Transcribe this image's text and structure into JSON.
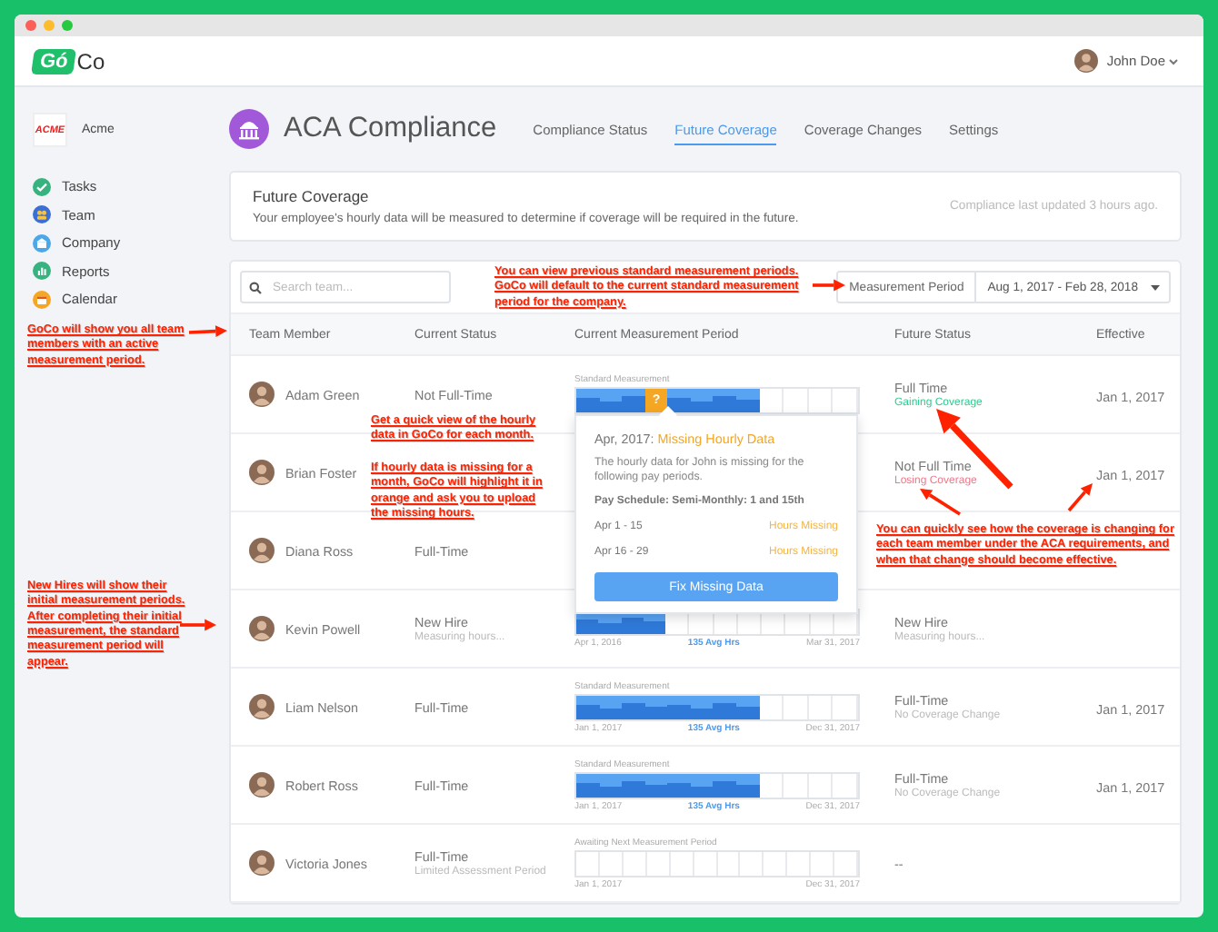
{
  "header": {
    "logo": {
      "mark": "Gó",
      "rest": "Co"
    },
    "user": {
      "name": "John Doe"
    }
  },
  "sidebar": {
    "company": {
      "logo": "ACME",
      "name": "Acme"
    },
    "items": [
      {
        "label": "Tasks",
        "kind": "tasks"
      },
      {
        "label": "Team",
        "kind": "team"
      },
      {
        "label": "Company",
        "kind": "company"
      },
      {
        "label": "Reports",
        "kind": "reports"
      },
      {
        "label": "Calendar",
        "kind": "calendar"
      }
    ]
  },
  "page": {
    "title": "ACA Compliance",
    "tabs": [
      {
        "label": "Compliance Status",
        "selected": false
      },
      {
        "label": "Future Coverage",
        "selected": true
      },
      {
        "label": "Coverage Changes",
        "selected": false
      },
      {
        "label": "Settings",
        "selected": false
      }
    ]
  },
  "summary": {
    "title": "Future Coverage",
    "description": "Your employee's hourly data will be measured to determine if coverage will be required in the future.",
    "updated": "Compliance last updated 3 hours ago."
  },
  "table": {
    "search": {
      "placeholder": "Search team..."
    },
    "period_filter": {
      "label": "Measurement Period",
      "value": "Aug 1, 2017 - Feb 28, 2018"
    },
    "columns": [
      "Team Member",
      "Current Status",
      "Current Measurement Period",
      "Future Status",
      "Effective"
    ],
    "rows": [
      {
        "name": "Adam Green",
        "current": {
          "status": "Not Full-Time"
        },
        "period": {
          "label": "Standard Measurement",
          "missing_mark": "?",
          "cells": [
            {
              "filled": true,
              "missing": false
            },
            {
              "filled": true,
              "missing": false
            },
            {
              "filled": true,
              "missing": false
            },
            {
              "filled": false,
              "missing": true
            },
            {
              "filled": true,
              "missing": false
            },
            {
              "filled": true,
              "missing": false
            },
            {
              "filled": true,
              "missing": false
            },
            {
              "filled": true,
              "missing": false
            },
            {
              "filled": false,
              "missing": false
            },
            {
              "filled": false,
              "missing": false
            },
            {
              "filled": false,
              "missing": false
            },
            {
              "filled": false,
              "missing": false
            }
          ]
        },
        "future": {
          "status": "Full Time",
          "note": "Gaining Coverage",
          "gaining": true,
          "losing": false
        },
        "effective": "Jan 1, 2017"
      },
      {
        "name": "Brian Foster",
        "future": {
          "status": "Not Full Time",
          "note": "Losing Coverage",
          "gaining": false,
          "losing": true
        },
        "effective": "Jan 1, 2017"
      },
      {
        "name": "Diana Ross",
        "current": {
          "status": "Full-Time"
        }
      },
      {
        "name": "Kevin Powell",
        "current": {
          "status": "New Hire",
          "note": "Measuring hours..."
        },
        "period": {
          "cells": [
            {
              "filled": true,
              "missing": false
            },
            {
              "filled": true,
              "missing": false
            },
            {
              "filled": true,
              "missing": false
            },
            {
              "filled": true,
              "missing": false
            },
            {
              "filled": false,
              "missing": false
            },
            {
              "filled": false,
              "missing": false
            },
            {
              "filled": false,
              "missing": false
            },
            {
              "filled": false,
              "missing": false
            },
            {
              "filled": false,
              "missing": false
            },
            {
              "filled": false,
              "missing": false
            },
            {
              "filled": false,
              "missing": false
            },
            {
              "filled": false,
              "missing": false
            }
          ],
          "start": "Apr 1, 2016",
          "average": "135 Avg Hrs",
          "end": "Mar 31, 2017"
        },
        "future": {
          "status": "New Hire",
          "note": "Measuring hours...",
          "gaining": false,
          "losing": false
        }
      },
      {
        "name": "Liam Nelson",
        "current": {
          "status": "Full-Time"
        },
        "period": {
          "label": "Standard Measurement",
          "cells": [
            {
              "filled": true,
              "missing": false
            },
            {
              "filled": true,
              "missing": false
            },
            {
              "filled": true,
              "missing": false
            },
            {
              "filled": true,
              "missing": false
            },
            {
              "filled": true,
              "missing": false
            },
            {
              "filled": true,
              "missing": false
            },
            {
              "filled": true,
              "missing": false
            },
            {
              "filled": true,
              "missing": false
            },
            {
              "filled": false,
              "missing": false
            },
            {
              "filled": false,
              "missing": false
            },
            {
              "filled": false,
              "missing": false
            },
            {
              "filled": false,
              "missing": false
            }
          ],
          "start": "Jan 1, 2017",
          "average": "135 Avg Hrs",
          "end": "Dec 31, 2017"
        },
        "future": {
          "status": "Full-Time",
          "note": "No Coverage Change",
          "gaining": false,
          "losing": false
        },
        "effective": "Jan 1, 2017"
      },
      {
        "name": "Robert Ross",
        "current": {
          "status": "Full-Time"
        },
        "period": {
          "label": "Standard Measurement",
          "cells": [
            {
              "filled": true,
              "missing": false
            },
            {
              "filled": true,
              "missing": false
            },
            {
              "filled": true,
              "missing": false
            },
            {
              "filled": true,
              "missing": false
            },
            {
              "filled": true,
              "missing": false
            },
            {
              "filled": true,
              "missing": false
            },
            {
              "filled": true,
              "missing": false
            },
            {
              "filled": true,
              "missing": false
            },
            {
              "filled": false,
              "missing": false
            },
            {
              "filled": false,
              "missing": false
            },
            {
              "filled": false,
              "missing": false
            },
            {
              "filled": false,
              "missing": false
            }
          ],
          "start": "Jan 1, 2017",
          "average": "135 Avg Hrs",
          "end": "Dec 31, 2017"
        },
        "future": {
          "status": "Full-Time",
          "note": "No Coverage Change",
          "gaining": false,
          "losing": false
        },
        "effective": "Jan 1, 2017"
      },
      {
        "name": "Victoria Jones",
        "current": {
          "status": "Full-Time",
          "note": "Limited Assessment Period"
        },
        "period": {
          "label": "Awaiting Next Measurement Period",
          "cells": [
            {
              "filled": false,
              "missing": false
            },
            {
              "filled": false,
              "missing": false
            },
            {
              "filled": false,
              "missing": false
            },
            {
              "filled": false,
              "missing": false
            },
            {
              "filled": false,
              "missing": false
            },
            {
              "filled": false,
              "missing": false
            },
            {
              "filled": false,
              "missing": false
            },
            {
              "filled": false,
              "missing": false
            },
            {
              "filled": false,
              "missing": false
            },
            {
              "filled": false,
              "missing": false
            },
            {
              "filled": false,
              "missing": false
            },
            {
              "filled": false,
              "missing": false
            }
          ],
          "start": "Jan 1, 2017",
          "end": "Dec 31, 2017"
        },
        "future": {
          "status": "--"
        }
      }
    ]
  },
  "popover": {
    "title": "Apr, 2017:",
    "status": "Missing Hourly Data",
    "description": "The hourly data for John is missing for the following pay periods.",
    "schedule": "Pay Schedule: Semi-Monthly: 1 and 15th",
    "periods": [
      {
        "range": "Apr 1 - 15",
        "status": "Hours Missing"
      },
      {
        "range": "Apr 16 - 29",
        "status": "Hours Missing"
      }
    ],
    "button": "Fix Missing Data"
  },
  "annotations": [
    {
      "text": "You can view previous standard measurement periods. GoCo will default to the current standard measurement period for the company."
    },
    {
      "text": "GoCo will show you all team members with an active measurement period."
    },
    {
      "text": "Get a quick view of the hourly data in GoCo for each month."
    },
    {
      "text": "If hourly data is missing for a month, GoCo will highlight it in orange and ask you to upload the missing hours."
    },
    {
      "text": "New Hires will show their initial measurement periods.  After completing their initial measurement, the standard measurement period will appear."
    },
    {
      "text": "You can quickly see how the coverage is changing for each team member under the ACA requirements, and when that change should become effective."
    }
  ]
}
